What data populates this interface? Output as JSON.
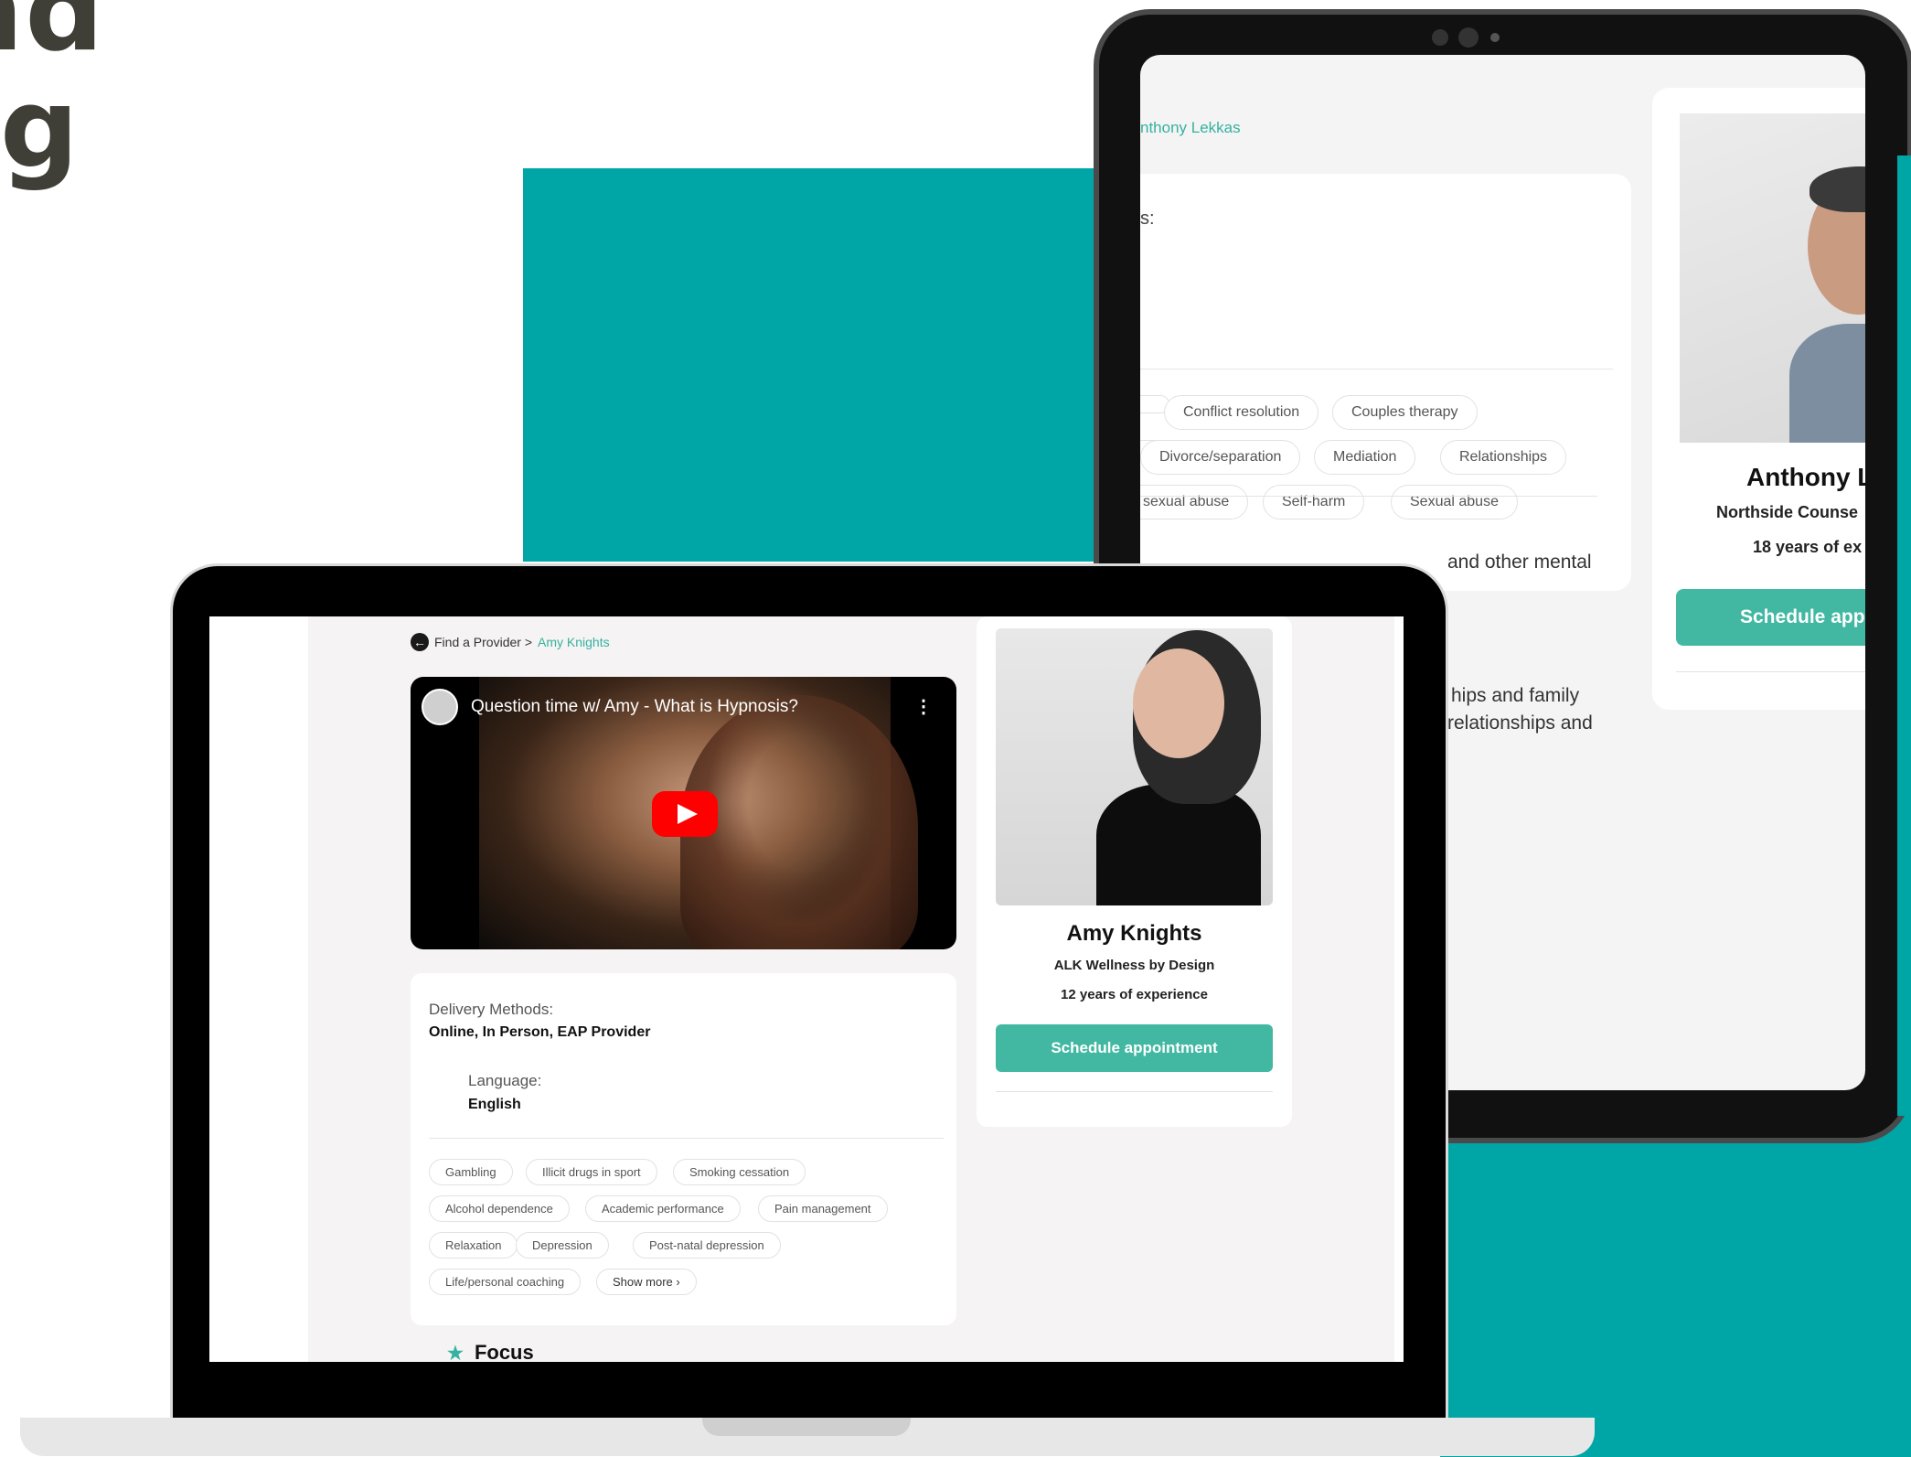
{
  "hero": {
    "line1": "nd",
    "line2": "g"
  },
  "tablet": {
    "breadcrumb": "nthony Lekkas",
    "card_label": "s:",
    "chips": [
      "Conflict resolution",
      "Couples therapy",
      "Divorce/separation",
      "Mediation",
      "Relationships",
      "sexual abuse",
      "Self-harm",
      "Sexual abuse"
    ],
    "body_text": [
      "and other mental",
      "hips and family",
      "relationships and"
    ],
    "profile": {
      "name": "Anthony L",
      "org": "Northside Counse",
      "experience": "18 years of ex",
      "button": "Schedule app"
    }
  },
  "laptop": {
    "breadcrumb": {
      "parent": "Find a Provider >",
      "current": "Amy Knights"
    },
    "video": {
      "title": "Question time w/ Amy - What is Hypnosis?",
      "menu_icon": "more-vertical-icon",
      "play_icon": "play-icon"
    },
    "info": {
      "delivery_label": "Delivery Methods:",
      "delivery_value": "Online, In Person, EAP Provider",
      "language_label": "Language:",
      "language_value": "English"
    },
    "chips": [
      "Gambling",
      "Illicit drugs in sport",
      "Smoking cessation",
      "Alcohol dependence",
      "Academic performance",
      "Pain management",
      "Relaxation",
      "Depression",
      "Post-natal depression",
      "Life/personal coaching",
      "Show more ›"
    ],
    "focus_label": "Focus",
    "profile": {
      "name": "Amy Knights",
      "org": "ALK Wellness by Design",
      "experience": "12 years of experience",
      "button": "Schedule appointment"
    }
  },
  "colors": {
    "teal": "#00a6a6",
    "accent_green": "#42b8a2",
    "link": "#36b2a0"
  }
}
